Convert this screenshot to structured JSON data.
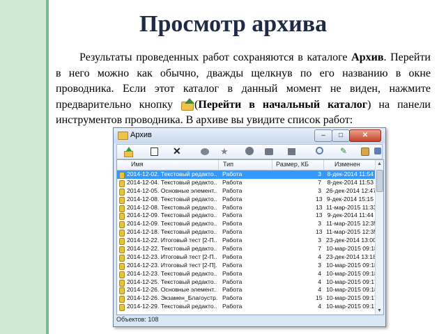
{
  "slide": {
    "title": "Просмотр архива",
    "text_part1": "Результаты проведенных работ сохраняются в каталоге ",
    "text_bold1": "Архив",
    "text_part2": ". Перейти в него можно как обычно, дважды щелкнув по его названию в окне проводника. Если этот каталог в данный момент не виден, нажмите предварительно кнопку ",
    "text_paren_open": "(",
    "text_bold2": "Перейти в начальный каталог",
    "text_part3": ") на панели инструментов проводника. В архиве вы увидите список работ:"
  },
  "window": {
    "title": "Архив",
    "controls": {
      "minimize": "–",
      "maximize": "□",
      "close": "✕"
    },
    "toolbar_icons": [
      "up-folder-icon",
      "new-folder-icon",
      "delete-icon",
      "view-icon",
      "favorite-icon",
      "play-icon",
      "edit-icon",
      "stop-icon",
      "search-icon",
      "record-icon",
      "settings-icon",
      "help-icon"
    ],
    "columns": {
      "name": "Имя",
      "type": "Тип",
      "size": "Размер, КБ",
      "date": "Изменен"
    },
    "rows": [
      {
        "name": "2014-12-02. Текстовый редакто...",
        "type": "Работа",
        "size": "3",
        "date": "8-дек-2014 11:54",
        "selected": true
      },
      {
        "name": "2014-12-04. Текстовый редакто...",
        "type": "Работа",
        "size": "7",
        "date": "8-дек-2014 11:53"
      },
      {
        "name": "2014-12-05. Основные элемент...",
        "type": "Работа",
        "size": "3",
        "date": "26-дек-2014 12:47"
      },
      {
        "name": "2014-12-08. Текстовый редакто...",
        "type": "Работа",
        "size": "13",
        "date": "9-дек-2014 15:15"
      },
      {
        "name": "2014-12-08. Текстовый редакто...",
        "type": "Работа",
        "size": "13",
        "date": "11-мар-2015 11:33"
      },
      {
        "name": "2014-12-09. Текстовый редакто...",
        "type": "Работа",
        "size": "13",
        "date": "9-дек-2014 11:44"
      },
      {
        "name": "2014-12-09. Текстовый редакто...",
        "type": "Работа",
        "size": "3",
        "date": "11-мар-2015 12:35"
      },
      {
        "name": "2014-12-18. Текстовый редакто...",
        "type": "Работа",
        "size": "13",
        "date": "11-мар-2015 12:35"
      },
      {
        "name": "2014-12-22. Итоговый тест [2-П...",
        "type": "Работа",
        "size": "3",
        "date": "23-дек-2014 13:00"
      },
      {
        "name": "2014-12-22. Текстовый редакто...",
        "type": "Работа",
        "size": "7",
        "date": "10-мар-2015 09:18"
      },
      {
        "name": "2014-12-23. Итоговый тест [2-П...",
        "type": "Работа",
        "size": "4",
        "date": "23-дек-2014 13:18"
      },
      {
        "name": "2014-12-23. Итоговый тест [2-П]...",
        "type": "Работа",
        "size": "3",
        "date": "10-мар-2015 09:18"
      },
      {
        "name": "2014-12-23. Текстовый редакто...",
        "type": "Работа",
        "size": "4",
        "date": "10-мар-2015 09:18"
      },
      {
        "name": "2014-12-25. Текстовый редакто...",
        "type": "Работа",
        "size": "4",
        "date": "10-мар-2015 09:17"
      },
      {
        "name": "2014-12-26. Основные элемент...",
        "type": "Работа",
        "size": "4",
        "date": "10-мар-2015 09:18"
      },
      {
        "name": "2014-12-26. Экзамен_Благоустр...",
        "type": "Работа",
        "size": "15",
        "date": "10-мар-2015 09:17"
      },
      {
        "name": "2014-12-29. Текстовый редакто...",
        "type": "Работа",
        "size": "4",
        "date": "10-мар-2015 09:17"
      }
    ],
    "status": "Объектов: 108"
  },
  "colors": {
    "accent_bar": "#cfe8d3",
    "title": "#1f2a44",
    "selection": "#3399ff"
  }
}
